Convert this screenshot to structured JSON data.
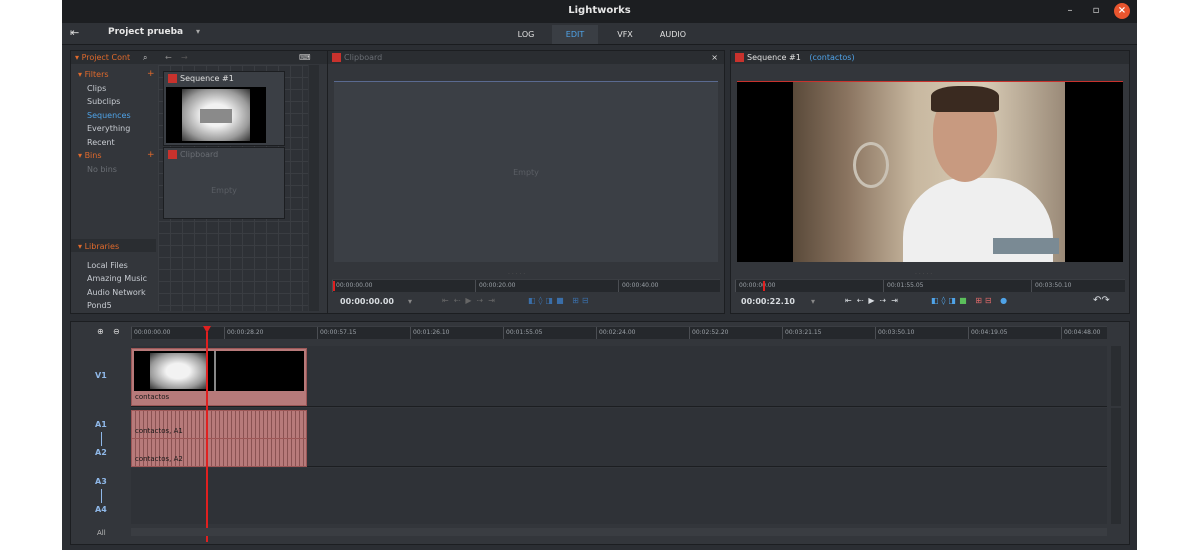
{
  "window": {
    "title": "Lightworks"
  },
  "menu": {
    "project_name": "Project prueba",
    "tabs": [
      {
        "label": "LOG",
        "active": false
      },
      {
        "label": "EDIT",
        "active": true
      },
      {
        "label": "VFX",
        "active": false
      },
      {
        "label": "AUDIO",
        "active": false
      }
    ]
  },
  "project_panel": {
    "title": "Project Cont",
    "filters_label": "Filters",
    "filters": [
      "Clips",
      "Subclips",
      "Sequences",
      "Everything",
      "Recent"
    ],
    "selected_filter": "Sequences",
    "bins_label": "Bins",
    "no_bins": "No bins",
    "libraries_label": "Libraries",
    "libraries": [
      "Local Files",
      "Amazing Music",
      "Audio Network",
      "Pond5"
    ],
    "items": [
      {
        "title": "Sequence #1"
      },
      {
        "title": "Clipboard",
        "empty": "Empty"
      }
    ]
  },
  "clipboard_viewer": {
    "title": "Clipboard",
    "empty": "Empty",
    "ruler": [
      "00:00:00.00",
      "00:00:20.00",
      "00:00:40.00"
    ],
    "timecode": "00:00:00.00"
  },
  "sequence_viewer": {
    "title": "Sequence #1",
    "subtitle": "(contactos)",
    "ruler": [
      "00:00:00.00",
      "00:01:55.05",
      "00:03:50.10"
    ],
    "timecode": "00:00:22.10"
  },
  "timeline": {
    "ruler": [
      "00:00:00.00",
      "00:00:28.20",
      "00:00:57.15",
      "00:01:26.10",
      "00:01:55.05",
      "00:02:24.00",
      "00:02:52.20",
      "00:03:21.15",
      "00:03:50.10",
      "00:04:19.05",
      "00:04:48.00"
    ],
    "tracks": [
      "V1",
      "A1",
      "A2",
      "A3",
      "A4"
    ],
    "all_label": "All",
    "clips": {
      "video": "contactos",
      "a1": "contactos, A1",
      "a2": "contactos, A2"
    }
  },
  "colors": {
    "accent": "#4fa3e8",
    "orange": "#e06a2c",
    "playhead": "#e02020",
    "clip": "#b77a7a",
    "close": "#e9552e"
  },
  "icons": [
    "exit-icon",
    "search-icon",
    "minimize-icon",
    "maximize-icon",
    "close-icon",
    "zoom-in-icon",
    "zoom-out-icon"
  ]
}
